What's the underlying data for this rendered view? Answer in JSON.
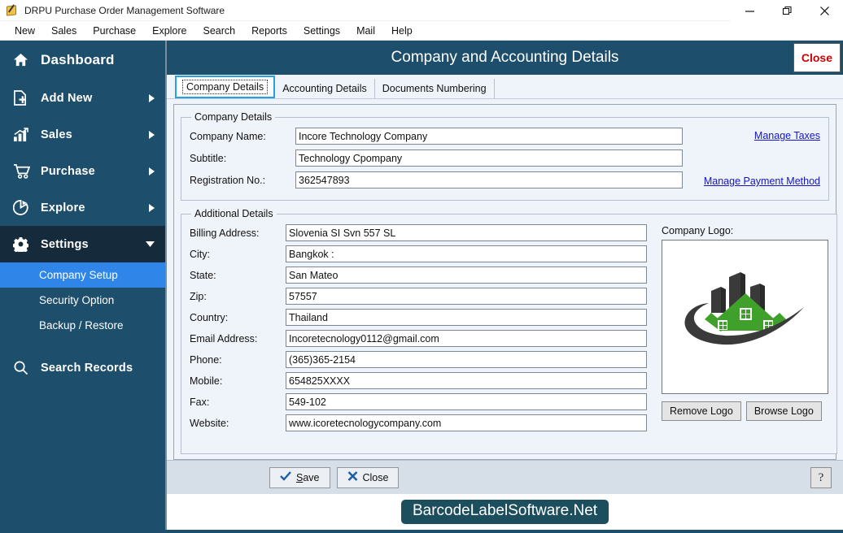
{
  "window": {
    "title": "DRPU Purchase Order Management Software",
    "icon": "app-icon",
    "buttons": {
      "minimize": "minimize-icon",
      "maximize": "maximize-icon",
      "close": "close-icon"
    }
  },
  "menubar": {
    "items": [
      "New",
      "Sales",
      "Purchase",
      "Explore",
      "Search",
      "Reports",
      "Settings",
      "Mail",
      "Help"
    ]
  },
  "sidebar": {
    "items": [
      {
        "label": "Dashboard",
        "icon": "home-icon",
        "arrow": "",
        "state": "normal"
      },
      {
        "label": "Add New",
        "icon": "file-plus-icon",
        "arrow": "right",
        "state": "normal"
      },
      {
        "label": "Sales",
        "icon": "bar-chart-icon",
        "arrow": "right",
        "state": "normal"
      },
      {
        "label": "Purchase",
        "icon": "cart-icon",
        "arrow": "right",
        "state": "normal"
      },
      {
        "label": "Explore",
        "icon": "pie-chart-icon",
        "arrow": "right",
        "state": "normal"
      },
      {
        "label": "Settings",
        "icon": "gear-icon",
        "arrow": "down",
        "state": "active"
      }
    ],
    "settings_children": [
      {
        "label": "Company Setup",
        "state": "selected"
      },
      {
        "label": "Security Option",
        "state": "normal"
      },
      {
        "label": "Backup / Restore",
        "state": "normal"
      }
    ],
    "search": {
      "label": "Search Records",
      "icon": "magnifier-icon"
    },
    "colors": {
      "background": "#1d4e6b",
      "active": "#152a3a",
      "selected": "#2f86e8"
    }
  },
  "page": {
    "title": "Company and Accounting Details",
    "close_label": "Close",
    "header_color": "#1d4e6b"
  },
  "tabs": [
    {
      "label": "Company Details",
      "active": true
    },
    {
      "label": "Accounting Details",
      "active": false
    },
    {
      "label": "Documents Numbering",
      "active": false
    }
  ],
  "company_details": {
    "legend": "Company Details",
    "fields": [
      {
        "label": "Company Name:",
        "value": "Incore Technology Company"
      },
      {
        "label": "Subtitle:",
        "value": "Technology Cpompany"
      },
      {
        "label": "Registration No.:",
        "value": "362547893"
      }
    ],
    "links": [
      {
        "label": "Manage Taxes"
      },
      {
        "label": "Manage Payment Method"
      }
    ],
    "link_color": "#1414cc"
  },
  "additional_details": {
    "legend": "Additional Details",
    "fields": [
      {
        "label": "Billing Address:",
        "value": "Slovenia SI Svn 557 SL"
      },
      {
        "label": "City:",
        "value": "Bangkok  :"
      },
      {
        "label": "State:",
        "value": "San Mateo"
      },
      {
        "label": "Zip:",
        "value": "57557"
      },
      {
        "label": "Country:",
        "value": "Thailand"
      },
      {
        "label": "Email Address:",
        "value": "Incoretecnology0112@gmail.com"
      },
      {
        "label": "Phone:",
        "value": "(365)365-2154"
      },
      {
        "label": "Mobile:",
        "value": "654825XXXX"
      },
      {
        "label": "Fax:",
        "value": "549-102"
      },
      {
        "label": "Website:",
        "value": "www.icoretecnologycompany.com"
      }
    ]
  },
  "logo": {
    "title": "Company Logo:",
    "icon": "company-logo-image",
    "colors": {
      "buildings": "#3a3a3a",
      "house": "#3fa12b",
      "swoosh": "#3a3a3a"
    },
    "buttons": [
      {
        "label": "Remove Logo"
      },
      {
        "label": "Browse Logo"
      }
    ]
  },
  "footer": {
    "save": {
      "label": "Save",
      "accel": "S",
      "icon": "check-icon"
    },
    "close": {
      "label": "Close",
      "icon": "x-icon"
    },
    "help": {
      "label": "?",
      "icon": "help-icon"
    }
  },
  "watermark": {
    "text": "BarcodeLabelSoftware.Net",
    "color": "#1d4e5e"
  }
}
